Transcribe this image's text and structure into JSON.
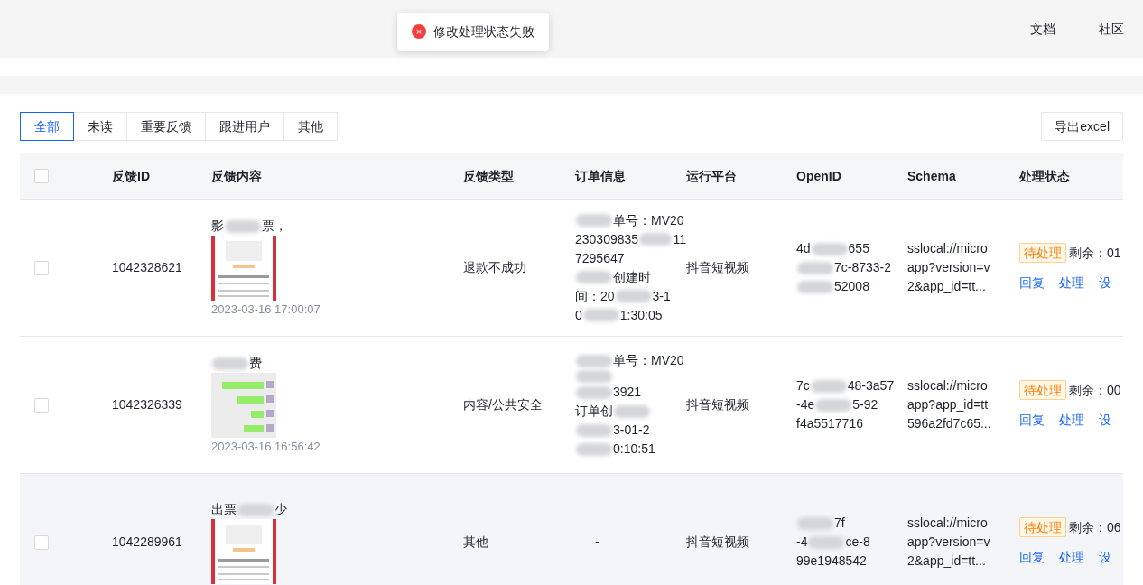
{
  "header": {
    "links": [
      "文档",
      "社区"
    ]
  },
  "toast": {
    "message": "修改处理状态失败",
    "icon": "×"
  },
  "tabs": [
    {
      "label": "全部",
      "selected": true
    },
    {
      "label": "未读",
      "selected": false
    },
    {
      "label": "重要反馈",
      "selected": false
    },
    {
      "label": "跟进用户",
      "selected": false
    },
    {
      "label": "其他",
      "selected": false
    }
  ],
  "export_button": "导出excel",
  "table": {
    "columns": [
      "反馈ID",
      "反馈内容",
      "反馈类型",
      "订单信息",
      "运行平台",
      "OpenID",
      "Schema",
      "处理状态"
    ],
    "header_checked": false,
    "rows": [
      {
        "checked": false,
        "id": "1042328621",
        "content": [
          {
            "kind": "text",
            "text": "影"
          },
          {
            "kind": "smudge"
          },
          {
            "kind": "text",
            "text": "票，"
          }
        ],
        "image": {
          "kind": "picture"
        },
        "time": "2023-03-16 17:00:07",
        "type": "退款不成功",
        "order": [
          [
            {
              "kind": "smudge"
            },
            {
              "kind": "text",
              "text": "单号：MV20"
            }
          ],
          [
            {
              "kind": "text",
              "text": "230309835"
            },
            {
              "kind": "smudge"
            },
            {
              "kind": "text",
              "text": "11"
            }
          ],
          [
            {
              "kind": "text",
              "text": "7295647"
            }
          ],
          [
            {
              "kind": "smudge"
            },
            {
              "kind": "text",
              "text": "创建时"
            }
          ],
          [
            {
              "kind": "text",
              "text": "间：20"
            },
            {
              "kind": "smudge"
            },
            {
              "kind": "text",
              "text": "3-1"
            }
          ],
          [
            {
              "kind": "text",
              "text": "0"
            },
            {
              "kind": "smudge"
            },
            {
              "kind": "text",
              "text": "1:30:05"
            }
          ]
        ],
        "platform": "抖音短视频",
        "openid": [
          [
            {
              "kind": "text",
              "text": "4d"
            },
            {
              "kind": "smudge"
            },
            {
              "kind": "text",
              "text": "655"
            }
          ],
          [
            {
              "kind": "smudge"
            },
            {
              "kind": "text",
              "text": "7c-8733-2"
            }
          ],
          [
            {
              "kind": "smudge"
            },
            {
              "kind": "text",
              "text": "52008"
            }
          ]
        ],
        "schema": [
          "sslocal://micro",
          "app?version=v",
          "2&app_id=tt..."
        ],
        "status": "待处理",
        "remaining": "剩余：01",
        "actions": [
          "回复",
          "处理",
          "设"
        ],
        "highlighted": false
      },
      {
        "checked": false,
        "id": "1042326339",
        "content": [
          {
            "kind": "smudge"
          },
          {
            "kind": "text",
            "text": "费"
          }
        ],
        "image": {
          "kind": "picture"
        },
        "time": "2023-03-16 16:56:42",
        "type": "内容/公共安全",
        "order": [
          [
            {
              "kind": "smudge"
            },
            {
              "kind": "text",
              "text": "单号：MV20"
            }
          ],
          [
            {
              "kind": "smudge"
            }
          ],
          [
            {
              "kind": "smudge"
            },
            {
              "kind": "text",
              "text": "3921"
            }
          ],
          [
            {
              "kind": "text",
              "text": "订单创"
            },
            {
              "kind": "smudge"
            }
          ],
          [
            {
              "kind": "smudge"
            },
            {
              "kind": "text",
              "text": "3-01-2"
            }
          ],
          [
            {
              "kind": "smudge"
            },
            {
              "kind": "text",
              "text": "0:10:51"
            }
          ]
        ],
        "platform": "抖音短视频",
        "openid": [
          [
            {
              "kind": "text",
              "text": "7c"
            },
            {
              "kind": "smudge"
            },
            {
              "kind": "text",
              "text": "48-3a57"
            }
          ],
          [
            {
              "kind": "text",
              "text": "-4e"
            },
            {
              "kind": "smudge"
            },
            {
              "kind": "text",
              "text": "5-92"
            }
          ],
          [
            {
              "kind": "text",
              "text": "f4a5517716"
            }
          ]
        ],
        "schema": [
          "sslocal://micro",
          "app?app_id=tt",
          "596a2fd7c65..."
        ],
        "status": "待处理",
        "remaining": "剩余：00",
        "actions": [
          "回复",
          "处理",
          "设"
        ],
        "highlighted": false
      },
      {
        "checked": false,
        "id": "1042289961",
        "content": [
          {
            "kind": "text",
            "text": "出票"
          },
          {
            "kind": "smudge"
          },
          {
            "kind": "text",
            "text": "少"
          }
        ],
        "image": {
          "kind": "picture"
        },
        "type": "其他",
        "order": [
          [
            {
              "kind": "text",
              "text": "-"
            }
          ]
        ],
        "platform": "抖音短视频",
        "openid": [
          [
            {
              "kind": "smudge"
            },
            {
              "kind": "text",
              "text": "7f"
            }
          ],
          [
            {
              "kind": "text",
              "text": "-4"
            },
            {
              "kind": "smudge"
            },
            {
              "kind": "text",
              "text": "ce-8"
            }
          ],
          [
            {
              "kind": "text",
              "text": "99e1948542"
            }
          ]
        ],
        "schema": [
          "sslocal://micro",
          "app?version=v",
          "2&app_id=tt..."
        ],
        "status": "待处理",
        "remaining": "剩余：06",
        "actions": [
          "回复",
          "处理",
          "设"
        ],
        "highlighted": true
      }
    ]
  }
}
